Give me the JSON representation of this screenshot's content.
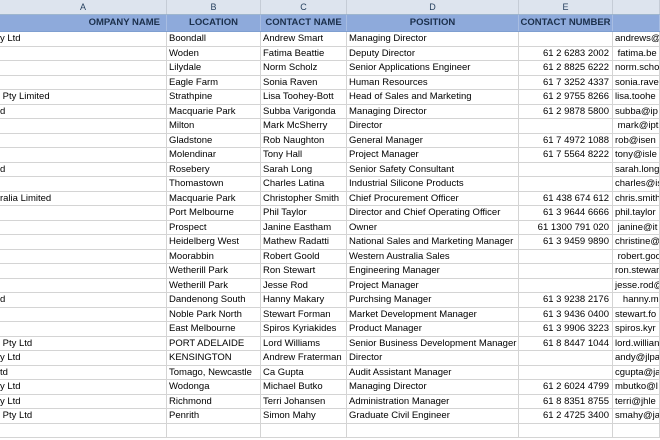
{
  "column_letters": [
    "A",
    "B",
    "C",
    "D",
    "E",
    ""
  ],
  "headers": [
    "OMPANY NAME",
    "LOCATION",
    "CONTACT NAME",
    "POSITION",
    "CONTACT NUMBER",
    ""
  ],
  "rows": [
    [
      "y Ltd",
      "Boondall",
      "Andrew Smart",
      "Managing Director",
      "",
      "andrews@i"
    ],
    [
      "",
      "Woden",
      "Fatima Beattie",
      "Deputy Director",
      "61 2 6283 2002",
      " fatima.be"
    ],
    [
      "",
      "Lilydale",
      "Norm Scholz",
      "Senior Applications Engineer",
      "61 2 8825 6222",
      "norm.scho"
    ],
    [
      "",
      "Eagle Farm",
      "Sonia Raven",
      "Human Resources",
      "61 7 3252 4337",
      "sonia.rave"
    ],
    [
      " Pty Limited",
      "Strathpine",
      "Lisa Toohey-Bott",
      "Head of Sales and Marketing",
      "61 2 9755 8266",
      "lisa.toohe"
    ],
    [
      "d",
      "Macquarie Park",
      "Subba Varigonda",
      "Managing Director",
      "61 2 9878 5800",
      "subba@ip"
    ],
    [
      "",
      "Milton",
      "Mark McSherry",
      "Director",
      "",
      " mark@ipt"
    ],
    [
      "",
      "Gladstone",
      "Rob Naughton",
      "General Manager",
      "61 7 4972 1088",
      "rob@isen"
    ],
    [
      "",
      "Molendinar",
      "Tony Hall",
      "Project Manager",
      "61 7 5564 8222",
      "tony@isle"
    ],
    [
      "d",
      "Rosebery",
      "Sarah Long",
      "Senior Safety Consultant",
      "",
      "sarah.long@"
    ],
    [
      "",
      "Thomastown",
      "Charles Latina",
      "Industrial Silicone Products",
      "",
      "charles@is"
    ],
    [
      "ralia Limited",
      "Macquarie Park",
      "Christopher Smith",
      "Chief Procurement Officer",
      "61 438 674 612",
      "chris.smith"
    ],
    [
      "",
      "Port Melbourne",
      "Phil Taylor",
      "Director and Chief Operating Officer",
      "61 3 9644 6666",
      "phil.taylor"
    ],
    [
      "",
      "Prospect",
      "Janine Eastham",
      "Owner",
      "61 1300 791 020",
      " janine@it"
    ],
    [
      "",
      "Heidelberg West",
      "Mathew Radatti",
      "National Sales and Marketing Manager",
      "61 3 9459 9890",
      "christine@"
    ],
    [
      "",
      "Moorabbin",
      "Robert Goold",
      "Western Australia Sales",
      "",
      " robert.goo"
    ],
    [
      "",
      "Wetherill Park",
      "Ron Stewart",
      "Engineering Manager",
      "",
      "ron.stewar"
    ],
    [
      "",
      "Wetherill Park",
      "Jesse Rod",
      "Project Manager",
      "",
      "jesse.rod@"
    ],
    [
      "d",
      "Dandenong South",
      "Hanny Makary",
      "Purchsing Manager",
      "61 3 9238 2176",
      "   hanny.m"
    ],
    [
      "",
      "Noble Park North",
      "Stewart Forman",
      "Market Development Manager",
      "61 3 9436 0400",
      "stewart.fo"
    ],
    [
      "",
      "East Melbourne",
      "Spiros Kyriakides",
      "Product Manager",
      "61 3 9906 3223",
      "spiros.kyr"
    ],
    [
      " Pty Ltd",
      "PORT ADELAIDE",
      "Lord Williams",
      "Senior Business Development Manager",
      "61 8 8447 1044",
      "lord.willian"
    ],
    [
      "y Ltd",
      "KENSINGTON",
      "Andrew Fraterman",
      "Director",
      "",
      "andy@jlpa"
    ],
    [
      "td",
      "Tomago, Newcastle",
      "Ca Gupta",
      "Audit Assistant Manager",
      "",
      "cgupta@ja"
    ],
    [
      "y Ltd",
      "Wodonga",
      "Michael Butko",
      "Managing Director",
      "61 2 6024 4799",
      "mbutko@l"
    ],
    [
      "y Ltd",
      "Richmond",
      "Terri Johansen",
      "Administration Manager",
      "61 8 8351 8755",
      "terri@jhle"
    ],
    [
      " Pty Ltd",
      "Penrith",
      "Simon Mahy",
      "Graduate Civil Engineer",
      "61 2 4725 3400",
      "smahy@ja"
    ],
    [
      "",
      "",
      "",
      "",
      "",
      ""
    ]
  ]
}
